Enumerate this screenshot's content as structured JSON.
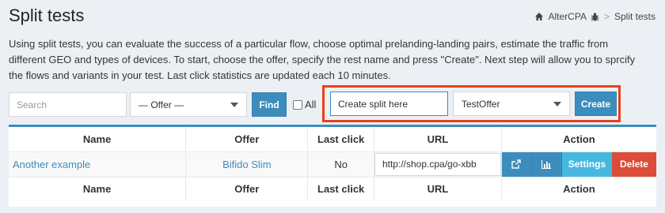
{
  "header": {
    "title": "Split tests",
    "breadcrumb_home": "AlterCPA",
    "breadcrumb_separator": ">",
    "breadcrumb_current": "Split tests"
  },
  "description": "Using split tests, you can evaluate the success of a particular flow, choose optimal prelanding-landing pairs, estimate the traffic from different GEO and types of devices. To start, choose the offer, specify the rest name and press \"Create\". Next step will allow you to sprcify the flows and variants in your test. Last click statistics are updated each 10 minutes.",
  "filters": {
    "search_placeholder": "Search",
    "offer_select": "— Offer —",
    "find_label": "Find",
    "all_label": "All"
  },
  "create": {
    "name_value": "Create split here",
    "offer_select": "TestOffer",
    "create_label": "Create"
  },
  "table": {
    "headers": [
      "Name",
      "Offer",
      "Last click",
      "URL",
      "Action"
    ],
    "rows": [
      {
        "name": "Another example",
        "offer": "Bifido Slim",
        "last_click": "No",
        "url": "http://shop.cpa/go-xbb",
        "actions": {
          "settings": "Settings",
          "delete": "Delete"
        }
      }
    ]
  },
  "colors": {
    "primary": "#3c8dbc",
    "info": "#46b8e0",
    "danger": "#dd4b39",
    "highlight": "#e8401c",
    "background": "#ecf0f5"
  }
}
